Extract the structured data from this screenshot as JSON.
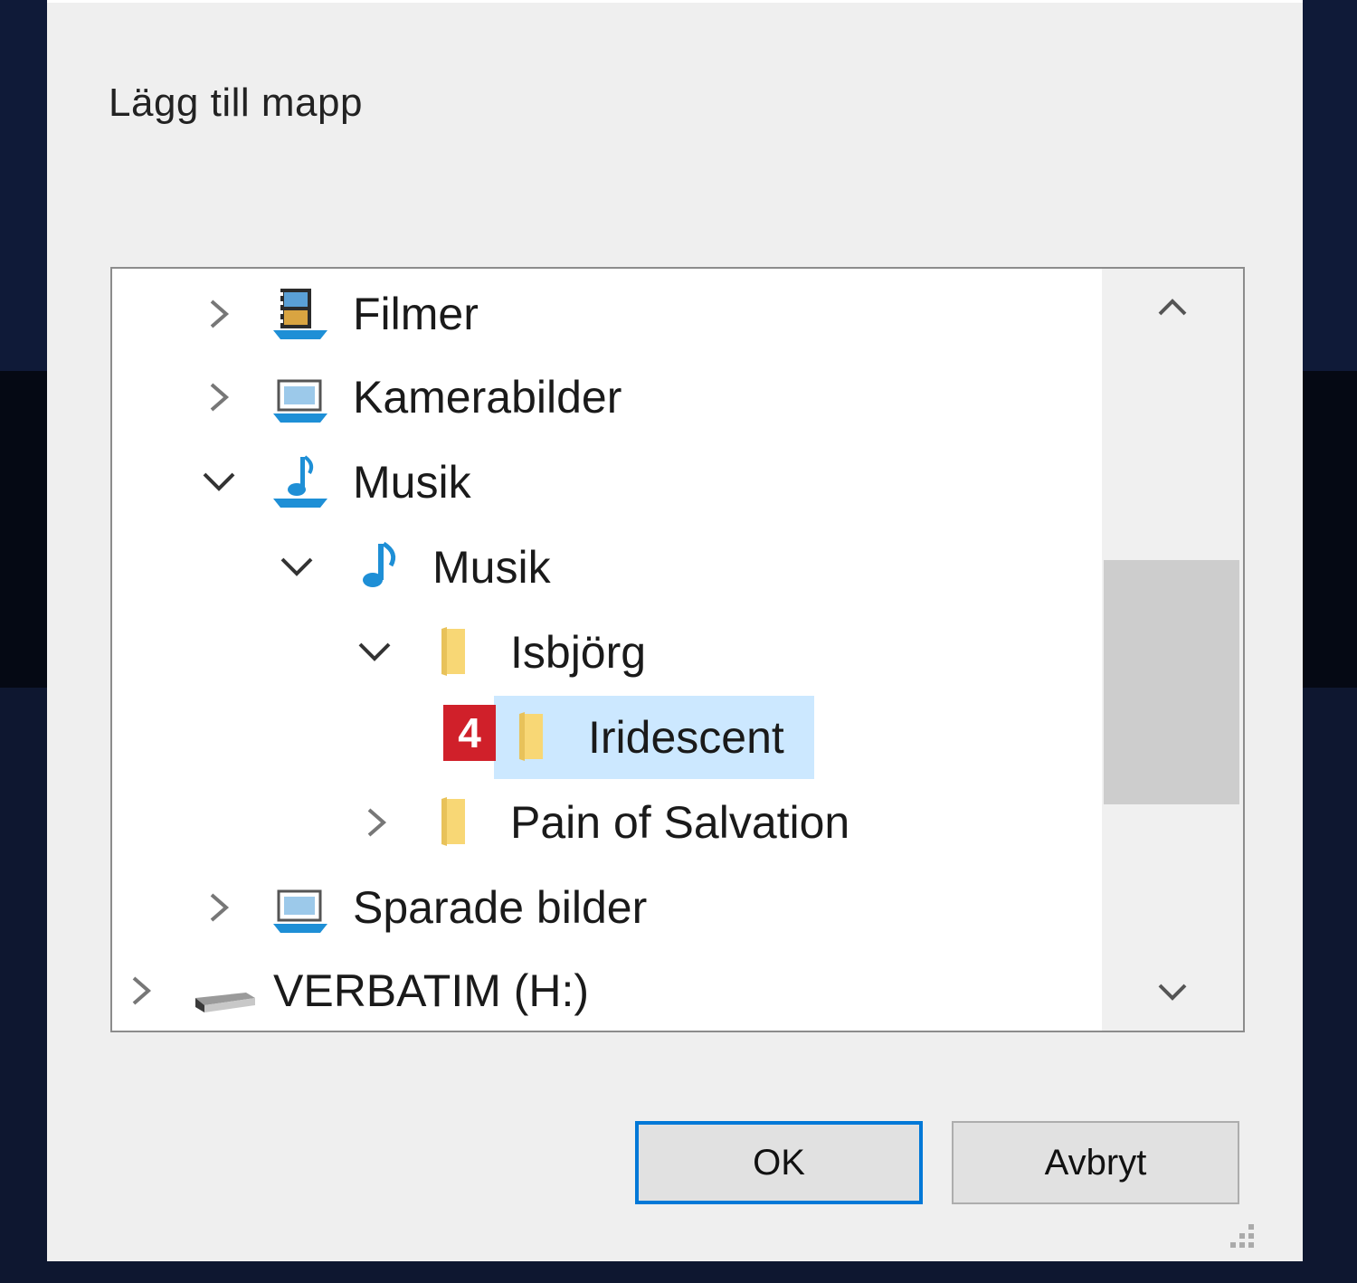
{
  "dialog": {
    "title": "Lägg till mapp"
  },
  "tree": {
    "items": [
      {
        "label": "Filmer",
        "expanded": false,
        "icon": "videos-library-icon"
      },
      {
        "label": "Kamerabilder",
        "expanded": false,
        "icon": "pictures-library-icon"
      },
      {
        "label": "Musik",
        "expanded": true,
        "icon": "music-library-icon"
      },
      {
        "label": "Musik",
        "expanded": true,
        "icon": "music-note-icon"
      },
      {
        "label": "Isbjörg",
        "expanded": true,
        "icon": "folder-icon"
      },
      {
        "label": "Iridescent",
        "selected": true,
        "icon": "folder-icon"
      },
      {
        "label": "Pain of Salvation",
        "expanded": false,
        "icon": "folder-icon"
      },
      {
        "label": "Sparade bilder",
        "expanded": false,
        "icon": "pictures-library-icon"
      },
      {
        "label": "VERBATIM (H:)",
        "expanded": false,
        "icon": "usb-drive-icon"
      }
    ],
    "callout_number": "4"
  },
  "buttons": {
    "ok": "OK",
    "cancel": "Avbryt"
  },
  "colors": {
    "selection": "#cce8ff",
    "focus_border": "#0078d7",
    "callout": "#d0202a",
    "library_blue": "#1e8fd6",
    "folder_yellow": "#f8d775"
  }
}
